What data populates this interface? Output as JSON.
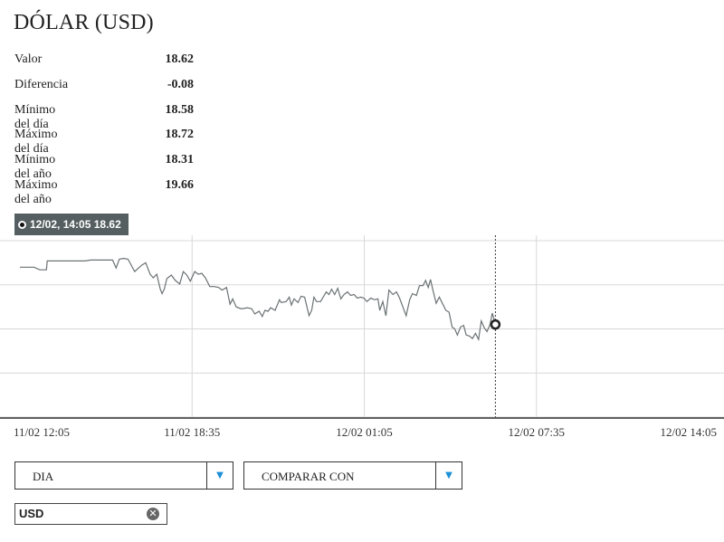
{
  "header": {
    "title": "DÓLAR (USD)"
  },
  "stats": [
    {
      "label": "Valor",
      "value": "18.62"
    },
    {
      "label": "Diferencia",
      "value": "-0.08"
    },
    {
      "label": "Mínimo del día",
      "value": "18.58"
    },
    {
      "label": "Máximo del día",
      "value": "18.72"
    },
    {
      "label": "Mínimo del año",
      "value": "18.31"
    },
    {
      "label": "Máximo del año",
      "value": "19.66"
    }
  ],
  "tooltip": {
    "text": "12/02, 14:05 18.62"
  },
  "controls": {
    "period_select": {
      "value": "DIA"
    },
    "compare_select": {
      "value": "COMPARAR CON"
    },
    "arrow_glyph": "▼"
  },
  "chips": [
    {
      "label": "USD",
      "close_glyph": "✕"
    }
  ],
  "colors": {
    "line": "#6b7274",
    "grid": "#d8d8d8",
    "dropdown_arrow": "#1b8fd6",
    "tooltip_bg": "#555e60"
  },
  "chart_data": {
    "type": "line",
    "title": "",
    "xlabel": "",
    "ylabel": "",
    "ylim": [
      18.55,
      18.75
    ],
    "grid": true,
    "x_ticks": [
      "11/02 12:05",
      "11/02 18:35",
      "12/02 01:05",
      "12/02 07:35",
      "12/02 14:05"
    ],
    "x_range_minutes": [
      0,
      1560
    ],
    "series": [
      {
        "points": [
          [
            0,
            18.72
          ],
          [
            32,
            18.72
          ],
          [
            45,
            18.717
          ],
          [
            60,
            18.717
          ],
          [
            62,
            18.727
          ],
          [
            90,
            18.727
          ],
          [
            120,
            18.727
          ],
          [
            148,
            18.727
          ],
          [
            160,
            18.728
          ],
          [
            200,
            18.728
          ],
          [
            210,
            18.728
          ],
          [
            218,
            18.719
          ],
          [
            225,
            18.729
          ],
          [
            235,
            18.73
          ],
          [
            245,
            18.729
          ],
          [
            260,
            18.715
          ],
          [
            275,
            18.722
          ],
          [
            285,
            18.725
          ],
          [
            295,
            18.712
          ],
          [
            302,
            18.708
          ],
          [
            310,
            18.712
          ],
          [
            318,
            18.695
          ],
          [
            322,
            18.69
          ],
          [
            327,
            18.695
          ],
          [
            333,
            18.707
          ],
          [
            343,
            18.711
          ],
          [
            352,
            18.705
          ],
          [
            362,
            18.701
          ],
          [
            370,
            18.715
          ],
          [
            378,
            18.711
          ],
          [
            386,
            18.704
          ],
          [
            396,
            18.715
          ],
          [
            404,
            18.712
          ],
          [
            412,
            18.713
          ],
          [
            420,
            18.708
          ],
          [
            430,
            18.698
          ],
          [
            440,
            18.698
          ],
          [
            450,
            18.697
          ],
          [
            458,
            18.694
          ],
          [
            468,
            18.697
          ],
          [
            476,
            18.678
          ],
          [
            482,
            18.684
          ],
          [
            490,
            18.675
          ],
          [
            500,
            18.673
          ],
          [
            505,
            18.673
          ],
          [
            515,
            18.674
          ],
          [
            525,
            18.673
          ],
          [
            532,
            18.667
          ],
          [
            542,
            18.67
          ],
          [
            549,
            18.664
          ],
          [
            555,
            18.671
          ],
          [
            562,
            18.67
          ],
          [
            568,
            18.674
          ],
          [
            578,
            18.671
          ],
          [
            588,
            18.683
          ],
          [
            592,
            18.68
          ],
          [
            603,
            18.681
          ],
          [
            610,
            18.686
          ],
          [
            615,
            18.677
          ],
          [
            621,
            18.684
          ],
          [
            630,
            18.68
          ],
          [
            637,
            18.687
          ],
          [
            645,
            18.686
          ],
          [
            655,
            18.665
          ],
          [
            661,
            18.671
          ],
          [
            666,
            18.686
          ],
          [
            672,
            18.681
          ],
          [
            681,
            18.681
          ],
          [
            694,
            18.692
          ],
          [
            700,
            18.689
          ],
          [
            706,
            18.695
          ],
          [
            713,
            18.689
          ],
          [
            720,
            18.696
          ],
          [
            727,
            18.684
          ],
          [
            734,
            18.689
          ],
          [
            742,
            18.692
          ],
          [
            749,
            18.688
          ],
          [
            757,
            18.689
          ],
          [
            764,
            18.685
          ],
          [
            772,
            18.686
          ],
          [
            779,
            18.685
          ],
          [
            786,
            18.681
          ],
          [
            795,
            18.685
          ],
          [
            803,
            18.683
          ],
          [
            811,
            18.684
          ],
          [
            815,
            18.671
          ],
          [
            822,
            18.681
          ],
          [
            829,
            18.665
          ],
          [
            836,
            18.694
          ],
          [
            845,
            18.689
          ],
          [
            853,
            18.692
          ],
          [
            860,
            18.685
          ],
          [
            875,
            18.665
          ],
          [
            883,
            18.683
          ],
          [
            889,
            18.69
          ],
          [
            898,
            18.688
          ],
          [
            905,
            18.699
          ],
          [
            913,
            18.699
          ],
          [
            919,
            18.705
          ],
          [
            925,
            18.697
          ],
          [
            930,
            18.706
          ],
          [
            936,
            18.693
          ],
          [
            943,
            18.679
          ],
          [
            950,
            18.686
          ],
          [
            958,
            18.678
          ],
          [
            965,
            18.671
          ],
          [
            972,
            18.669
          ],
          [
            979,
            18.652
          ],
          [
            985,
            18.65
          ],
          [
            991,
            18.643
          ],
          [
            998,
            18.652
          ],
          [
            1005,
            18.654
          ],
          [
            1011,
            18.643
          ],
          [
            1018,
            18.642
          ],
          [
            1025,
            18.639
          ],
          [
            1032,
            18.645
          ],
          [
            1039,
            18.638
          ],
          [
            1045,
            18.659
          ],
          [
            1052,
            18.651
          ],
          [
            1058,
            18.647
          ],
          [
            1065,
            18.655
          ],
          [
            1070,
            18.668
          ],
          [
            1077,
            18.655
          ]
        ]
      }
    ]
  }
}
